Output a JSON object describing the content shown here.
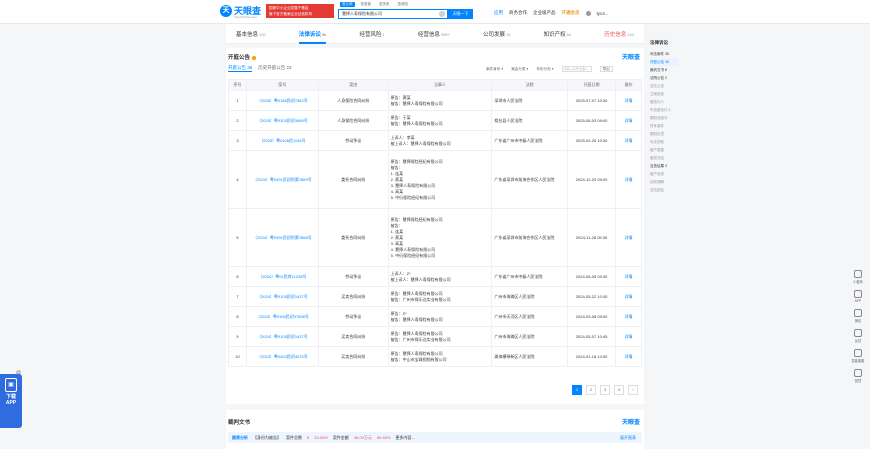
{
  "header": {
    "logo_text": "天眼查",
    "logo_sub": "TianYanCha.com",
    "banner_line1": "国家中小企业发展子基金",
    "banner_line2": "旗下官方备案企业征信机构",
    "search_tabs": [
      "查公司",
      "查老板",
      "查关系",
      "查风险"
    ],
    "search_value": "慧择人寿保险有限公司",
    "search_button": "天眼一下",
    "nav": [
      "应用",
      "商务合作",
      "企业级产品",
      "开通会员",
      "tyc4..."
    ]
  },
  "tabs": [
    {
      "label": "基本信息",
      "count": "100"
    },
    {
      "label": "法律诉讼",
      "count": "9k"
    },
    {
      "label": "经营风险",
      "count": "1"
    },
    {
      "label": "经营信息",
      "count": "999+"
    },
    {
      "label": "公司发展",
      "count": "15"
    },
    {
      "label": "知识产权",
      "count": "54"
    },
    {
      "label": "历史信息",
      "count": "144"
    }
  ],
  "section": {
    "title": "开庭公告",
    "brand": "天眼查",
    "subtabs": [
      "开庭公告 36",
      "历史开庭公告 23"
    ],
    "filters": [
      "案件身份",
      "案由分类",
      "年份分布"
    ],
    "search_placeholder": "请输入案号/当事人",
    "export": "导出"
  },
  "table": {
    "headers": [
      "序号",
      "案号",
      "案由",
      "当事人",
      "法院",
      "开庭日期",
      "操作"
    ],
    "rows": [
      {
        "no": "1",
        "case": "（2025）粤0185民初7362号",
        "cause": "人身保险合同纠纷",
        "parties": [
          "原告：黄某",
          "被告：慧择人寿保险有限公司"
        ],
        "court": "深圳市人民法院",
        "date": "2025-07-07 10:30",
        "op": "详情"
      },
      {
        "no": "2",
        "case": "（2025）粤0303民初3089号",
        "cause": "人身保险合同纠纷",
        "parties": [
          "原告：于某",
          "被告：慧择人寿保险有限公司"
        ],
        "court": "相台县人民法院",
        "date": "2025-06-03 09:00",
        "op": "详情"
      },
      {
        "no": "3",
        "case": "（2025）粤0106民1134号",
        "cause": "劳动争议",
        "parties": [
          "上诉人：李某",
          "被上诉人：慧择人寿保险有限公司"
        ],
        "court": "广东省广州市中级人民法院",
        "date": "2025-02-25 10:30",
        "op": "详情"
      },
      {
        "no": "4",
        "case": "（2024）粤0391民初刑第7869号",
        "cause": "委托合同纠纷",
        "parties": [
          "原告：慧择保险经纪有限公司",
          "被告：",
          "1. 连某",
          "2. 蔡某",
          "3. 慧择人寿保险有限公司",
          "4. 高某",
          "5. 中衍保险经纪有限公司"
        ],
        "court": "广东省深圳市前海合作区人民法院",
        "date": "2024-12-20 09:00",
        "op": "详情"
      },
      {
        "no": "5",
        "case": "（2024）粤0391民初刑第7868号",
        "cause": "委托合同纠纷",
        "parties": [
          "原告：慧择保险经纪有限公司",
          "被告：",
          "1. 连某",
          "2. 蔡某",
          "3. 高某",
          "4. 慧择人寿保险有限公司",
          "5. 中衍保险经纪有限公司"
        ],
        "court": "广东省深圳市前海合作区人民法院",
        "date": "2024-11-28 09:30",
        "op": "详情"
      },
      {
        "no": "6",
        "case": "（2024）粤01民终11228号",
        "cause": "劳动争议",
        "parties": [
          "上诉人：Z*",
          "被上诉人：慧择人寿保险有限公司"
        ],
        "court": "广东省广州市中级人民法院",
        "date": "2024-06-05 09:30",
        "op": "详情"
      },
      {
        "no": "7",
        "case": "（2024）粤0105民初1437号",
        "cause": "买卖合同纠纷",
        "parties": [
          "原告：慧择人寿保险有限公司",
          "被告：广州市保乐达实业有限公司"
        ],
        "court": "广州市海珠区人民法院",
        "date": "2024-05-22 10:30",
        "op": "详情"
      },
      {
        "no": "8",
        "case": "（2023）粤0106民初37698号",
        "cause": "劳动争议",
        "parties": [
          "原告：Z*",
          "被告：慧择人寿保险有限公司"
        ],
        "court": "广州市天河区人民法院",
        "date": "2024-03-08 09:00",
        "op": "详情"
      },
      {
        "no": "9",
        "case": "（2024）粤0105民初1437号",
        "cause": "买卖合同纠纷",
        "parties": [
          "原告：慧择人寿保险有限公司",
          "被告：广州市保乐达实业有限公司"
        ],
        "court": "广州市海珠区人民法院",
        "date": "2024-05-07 10:45",
        "op": "详情"
      },
      {
        "no": "10",
        "case": "（2023）粤0403民初4070号",
        "cause": "买卖合同纠纷",
        "parties": [
          "原告：慧择人寿保险有限公司",
          "被告：中山市宝珠视频有限公司"
        ],
        "court": "珠海横琴新区人民法院",
        "date": "2024-01-18 14:30",
        "op": "详情"
      }
    ]
  },
  "pager": [
    "1",
    "2",
    "3",
    "4",
    "›"
  ],
  "judgments": {
    "title": "裁判文书",
    "brand": "天眼查",
    "analysis_title": "图表分析",
    "identity_label": "【身份为被告】",
    "case_count_label": "案件总数",
    "case_count": "8",
    "case_pct": "33.33%",
    "amount_label": "案件金额",
    "amount": "45.00万元",
    "amount_pct": "66.85%",
    "more": "更多内容...",
    "expand": "展开图表"
  },
  "sidenav": {
    "head": "法律诉讼",
    "items": [
      "司法案件 38",
      "开庭公告 36",
      "裁判文书 8",
      "法院公告 2",
      "送达公告",
      "立案信息",
      "被执行人",
      "失信被执行人",
      "限制消费令",
      "终本案件",
      "限制出境",
      "司法协助",
      "破产重整",
      "股权冻结",
      "互查结果 3",
      "破产信息",
      "诉前调解",
      "送达回证"
    ]
  },
  "rtools": [
    "小程序",
    "APP",
    "微信",
    "反馈",
    "智能客服",
    "回顶"
  ],
  "appdl": {
    "line1": "下载",
    "line2": "APP"
  }
}
